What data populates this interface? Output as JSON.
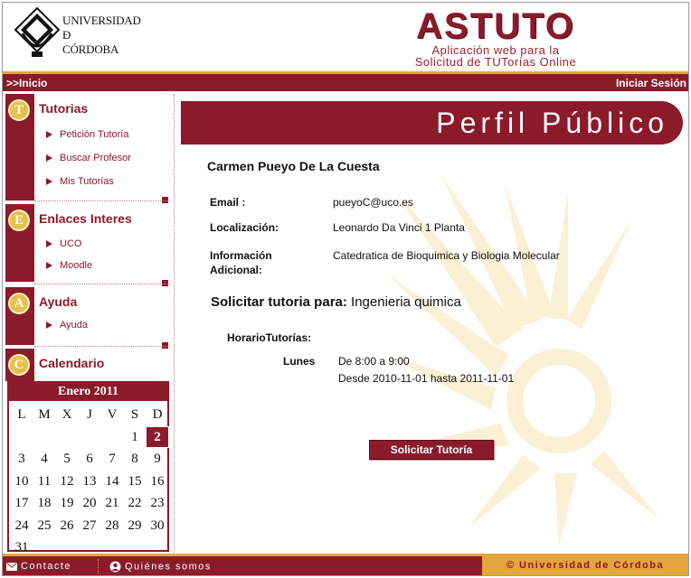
{
  "header": {
    "university_lines": [
      "UNIVERSIDAD",
      "Ð",
      "CÓRDOBA"
    ],
    "brand_title": "ASTUTO",
    "brand_subtitle_1": "Aplicación web para la",
    "brand_subtitle_2": "Solicitud de TUTorías Online"
  },
  "topbar": {
    "home": ">>Inicio",
    "login": "Iniciar Sesión"
  },
  "sidebar": {
    "sections": [
      {
        "letter": "T",
        "title": "Tutorias",
        "items": [
          "Petición Tutoría",
          "Buscar Profesor",
          "Mis Tutorías"
        ]
      },
      {
        "letter": "E",
        "title": "Enlaces Interes",
        "items": [
          "UCO",
          "Moodle"
        ]
      },
      {
        "letter": "A",
        "title": "Ayuda",
        "items": [
          "Ayuda"
        ]
      },
      {
        "letter": "C",
        "title": "Calendario",
        "items": []
      }
    ]
  },
  "calendar": {
    "month": "Enero 2011",
    "weekdays": [
      "L",
      "M",
      "X",
      "J",
      "V",
      "S",
      "D"
    ],
    "first_weekday_index": 5,
    "days": 31,
    "today": 2
  },
  "main": {
    "banner_title": "Perfil Público",
    "professor_name": "Carmen Pueyo De La Cuesta",
    "email_label": "Email :",
    "email_value": "pueyoC@uco.es",
    "location_label": "Localización:",
    "location_value": "Leonardo Da Vinci 1 Planta",
    "info_label_1": "Información",
    "info_label_2": "Adicional:",
    "info_value": "Catedratica de Bioquimica y Biologia Molecular",
    "request_label": "Solicitar tutoria para:",
    "request_subject": "Ingenieria quimica",
    "schedule_label": "HorarioTutorías:",
    "day": "Lunes",
    "time": "De 8:00 a 9:00",
    "range": "Desde 2010-11-01 hasta 2011-11-01",
    "button": "Solicitar Tutoría"
  },
  "footer": {
    "contact": "Contacte",
    "about": "Quiénes somos",
    "copyright": "© Universidad de Córdoba"
  },
  "colors": {
    "brand": "#8b1a2b",
    "accent": "#e4a53d",
    "badge": "#e8c04a"
  }
}
